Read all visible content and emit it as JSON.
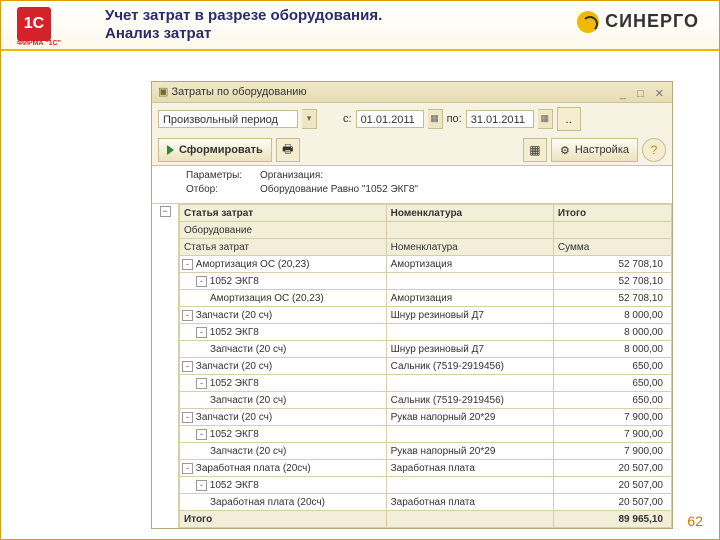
{
  "slide": {
    "title": "Учет затрат в разрезе оборудования.\nАнализ затрат",
    "logo1c": "ФИРМА \"1С\"",
    "logoSin": "СИНЕРГО",
    "pagenum": "62"
  },
  "win": {
    "title": "Затраты по оборудованию",
    "period_mode": "Произвольный период",
    "from_lbl": "с:",
    "from": "01.01.2011",
    "to_lbl": "по:",
    "to": "31.01.2011",
    "btn_form": "Сформировать",
    "btn_settings": "Настройка",
    "help": "?",
    "params_lbl": "Параметры:",
    "params_val": "Организация:",
    "filter_lbl": "Отбор:",
    "filter_val": "Оборудование Равно \"1052 ЭКГ8\""
  },
  "cols": {
    "c1": "Статья затрат",
    "c2": "Номенклатура",
    "c3": "Итого",
    "r1": "Оборудование",
    "s1": "Статья затрат",
    "s2": "Номенклатура",
    "s3": "Сумма"
  },
  "rows": [
    {
      "lvl": 1,
      "exp": "-",
      "a": "Амортизация ОС (20,23)",
      "b": "Амортизация",
      "c": "52 708,10"
    },
    {
      "lvl": 2,
      "exp": "-",
      "a": "1052 ЭКГ8",
      "b": "",
      "c": "52 708,10"
    },
    {
      "lvl": 3,
      "exp": "",
      "a": "Амортизация ОС (20,23)",
      "b": "Амортизация",
      "c": "52 708,10"
    },
    {
      "lvl": 1,
      "exp": "-",
      "a": "Запчасти (20 сч)",
      "b": "Шнур резиновый Д7",
      "c": "8 000,00"
    },
    {
      "lvl": 2,
      "exp": "-",
      "a": "1052 ЭКГ8",
      "b": "",
      "c": "8 000,00"
    },
    {
      "lvl": 3,
      "exp": "",
      "a": "Запчасти (20 сч)",
      "b": "Шнур резиновый Д7",
      "c": "8 000,00"
    },
    {
      "lvl": 1,
      "exp": "-",
      "a": "Запчасти (20 сч)",
      "b": "Сальник (7519-2919456)",
      "c": "650,00"
    },
    {
      "lvl": 2,
      "exp": "-",
      "a": "1052 ЭКГ8",
      "b": "",
      "c": "650,00"
    },
    {
      "lvl": 3,
      "exp": "",
      "a": "Запчасти (20 сч)",
      "b": "Сальник (7519-2919456)",
      "c": "650,00"
    },
    {
      "lvl": 1,
      "exp": "-",
      "a": "Запчасти (20 сч)",
      "b": "Рукав напорный 20*29",
      "c": "7 900,00"
    },
    {
      "lvl": 2,
      "exp": "-",
      "a": "1052 ЭКГ8",
      "b": "",
      "c": "7 900,00"
    },
    {
      "lvl": 3,
      "exp": "",
      "a": "Запчасти (20 сч)",
      "b": "Рукав напорный 20*29",
      "c": "7 900,00"
    },
    {
      "lvl": 1,
      "exp": "-",
      "a": "Заработная плата (20сч)",
      "b": "Заработная плата",
      "c": "20 507,00"
    },
    {
      "lvl": 2,
      "exp": "-",
      "a": "1052 ЭКГ8",
      "b": "",
      "c": "20 507,00"
    },
    {
      "lvl": 3,
      "exp": "",
      "a": "Заработная плата (20сч)",
      "b": "Заработная плата",
      "c": "20 507,00"
    }
  ],
  "total": {
    "label": "Итого",
    "value": "89 965,10"
  }
}
